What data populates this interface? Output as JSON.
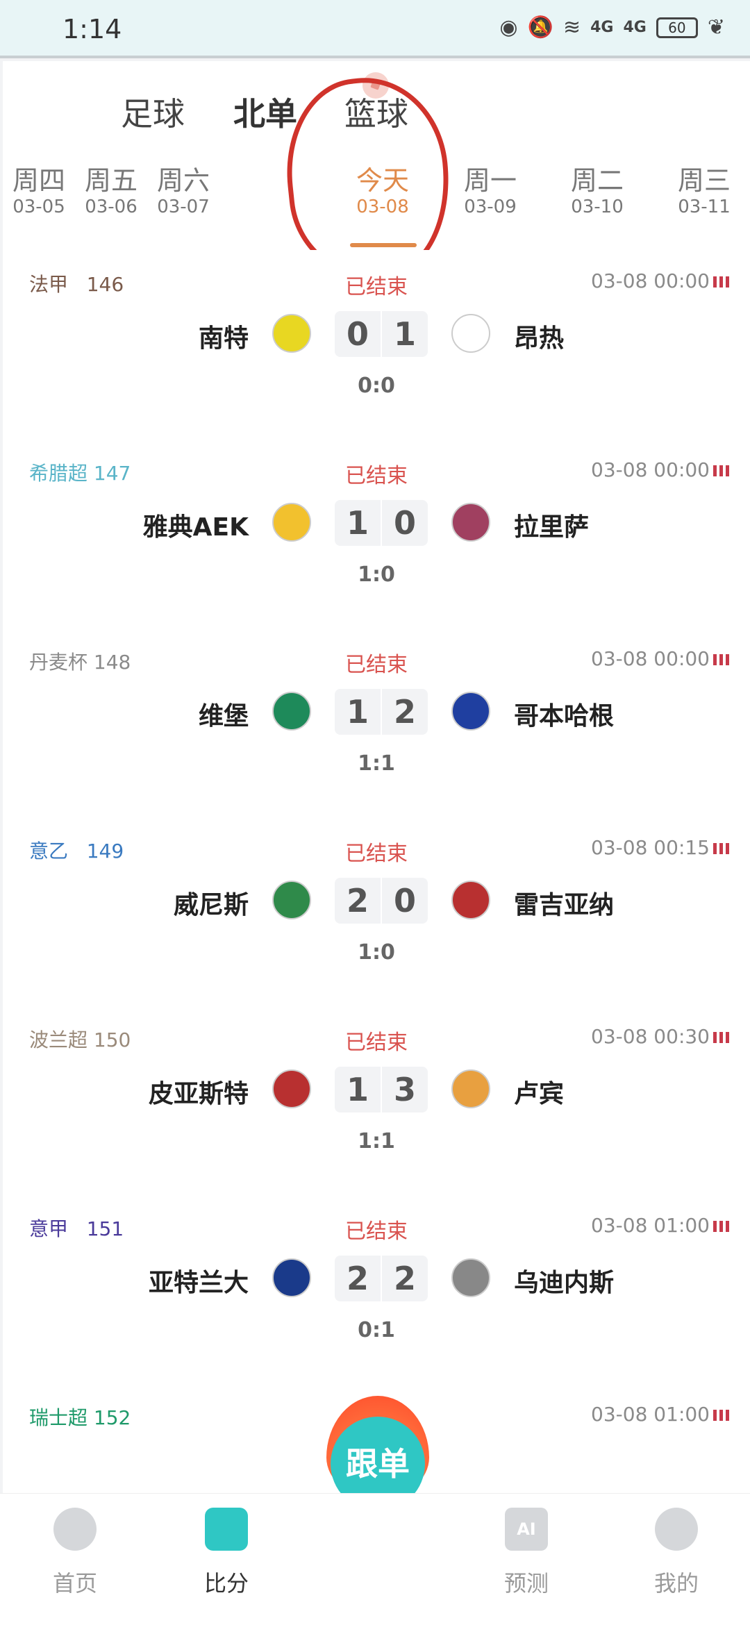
{
  "status_bar": {
    "time": "1:14",
    "network": "4G",
    "battery": "60"
  },
  "top_tabs": [
    {
      "label": "足球"
    },
    {
      "label": "北单"
    },
    {
      "label": "篮球"
    }
  ],
  "date_tabs": [
    {
      "day": "周四",
      "date": "03-05"
    },
    {
      "day": "周五",
      "date": "03-06"
    },
    {
      "day": "周六",
      "date": "03-07"
    },
    {
      "day": "今天",
      "date": "03-08"
    },
    {
      "day": "周一",
      "date": "03-09"
    },
    {
      "day": "周二",
      "date": "03-10"
    },
    {
      "day": "周三",
      "date": "03-11"
    }
  ],
  "matches": [
    {
      "league": "法甲",
      "num": "146",
      "status": "已结束",
      "time": "03-08 00:00",
      "home": "南特",
      "away": "昂热",
      "home_score": "0",
      "away_score": "1",
      "half": "0:0",
      "league_color": "#7a5a4a",
      "home_logo_color": "#e8d722",
      "away_logo_color": "#ffffff"
    },
    {
      "league": "希腊超",
      "num": "147",
      "status": "已结束",
      "time": "03-08 00:00",
      "home": "雅典AEK",
      "away": "拉里萨",
      "home_score": "1",
      "away_score": "0",
      "half": "1:0",
      "league_color": "#5ab4c8",
      "home_logo_color": "#f2c12e",
      "away_logo_color": "#a04060"
    },
    {
      "league": "丹麦杯",
      "num": "148",
      "status": "已结束",
      "time": "03-08 00:00",
      "home": "维堡",
      "away": "哥本哈根",
      "home_score": "1",
      "away_score": "2",
      "half": "1:1",
      "league_color": "#8a8a8a",
      "home_logo_color": "#1e8a5a",
      "away_logo_color": "#1f3fa0"
    },
    {
      "league": "意乙",
      "num": "149",
      "status": "已结束",
      "time": "03-08 00:15",
      "home": "威尼斯",
      "away": "雷吉亚纳",
      "home_score": "2",
      "away_score": "0",
      "half": "1:0",
      "league_color": "#3a7ac0",
      "home_logo_color": "#2f8a4a",
      "away_logo_color": "#b83030"
    },
    {
      "league": "波兰超",
      "num": "150",
      "status": "已结束",
      "time": "03-08 00:30",
      "home": "皮亚斯特",
      "away": "卢宾",
      "home_score": "1",
      "away_score": "3",
      "half": "1:1",
      "league_color": "#9a8a7a",
      "home_logo_color": "#b83030",
      "away_logo_color": "#e8a040"
    },
    {
      "league": "意甲",
      "num": "151",
      "status": "已结束",
      "time": "03-08 01:00",
      "home": "亚特兰大",
      "away": "乌迪内斯",
      "home_score": "2",
      "away_score": "2",
      "half": "0:1",
      "league_color": "#4a3a9a",
      "home_logo_color": "#1a3a8a",
      "away_logo_color": "#888888"
    },
    {
      "league": "瑞士超",
      "num": "152",
      "status": "",
      "time": "03-08 01:00",
      "home": "",
      "away": "",
      "home_score": "",
      "away_score": "",
      "half": "",
      "league_color": "#1f9a6a",
      "home_logo_color": "",
      "away_logo_color": ""
    }
  ],
  "fab": {
    "label": "跟单"
  },
  "bottom_nav": [
    {
      "label": "首页",
      "icon": "football-icon"
    },
    {
      "label": "比分",
      "icon": "score-icon"
    },
    {
      "label": "预测",
      "icon": "ai-icon",
      "icon_text": "AI"
    },
    {
      "label": "我的",
      "icon": "profile-icon"
    }
  ],
  "colors": {
    "accent": "#2fc7c4",
    "date_active": "#e08a4a",
    "status_red": "#d9534f",
    "annotation_red": "#d0332b"
  }
}
